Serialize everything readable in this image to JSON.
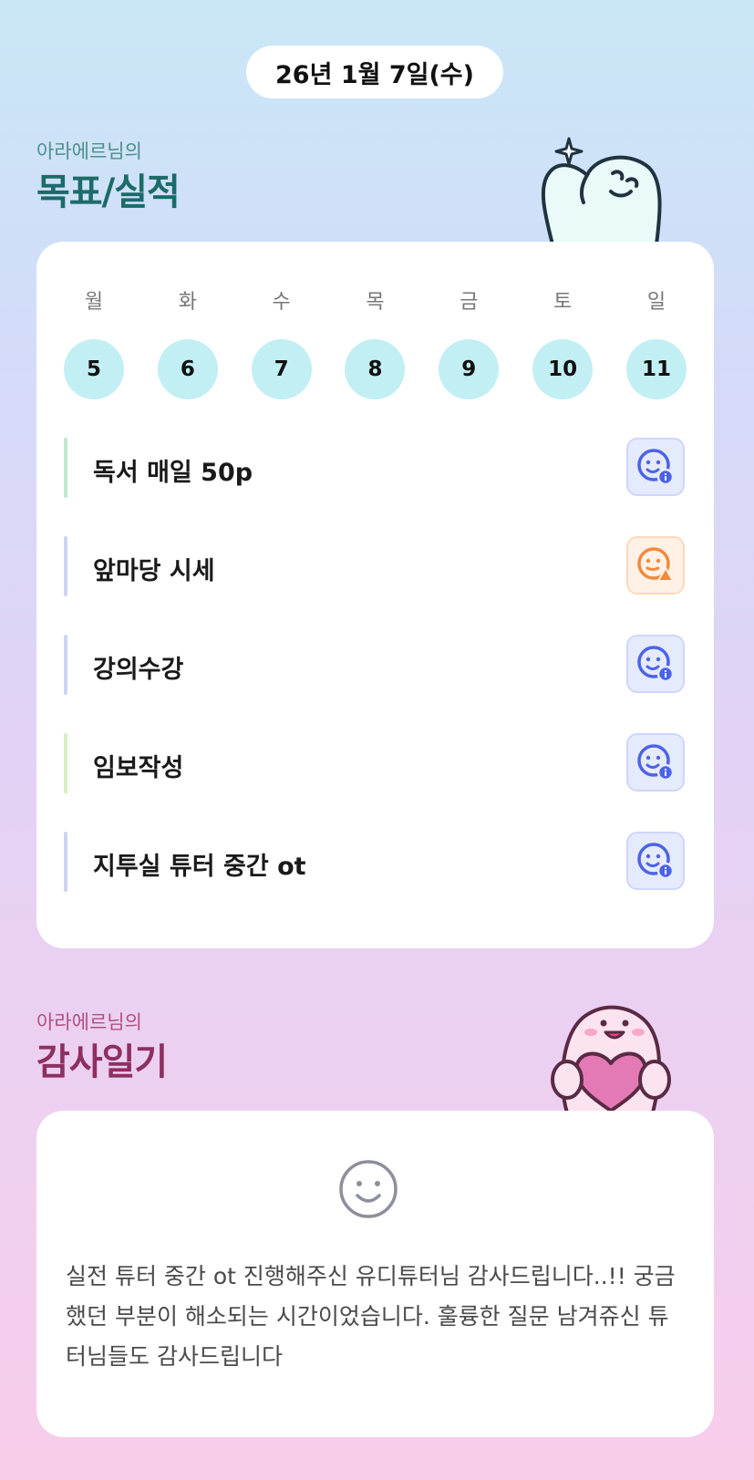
{
  "header": {
    "date": "26년 1월 7일(수)"
  },
  "goals_section": {
    "subtitle": "아라에르님의",
    "title": "목표/실적",
    "week": {
      "days": [
        "월",
        "화",
        "수",
        "목",
        "금",
        "토",
        "일"
      ],
      "dates": [
        "5",
        "6",
        "7",
        "8",
        "9",
        "10",
        "11"
      ]
    },
    "items": [
      {
        "label": "독서 매일 50p",
        "accent": "#bfe9cf",
        "status": "good",
        "status_icon": "smiley-info-icon"
      },
      {
        "label": "앞마당 시세",
        "accent": "#cdd3f1",
        "status": "warn",
        "status_icon": "smiley-warning-icon"
      },
      {
        "label": "강의수강",
        "accent": "#cdd3f1",
        "status": "good",
        "status_icon": "smiley-info-icon"
      },
      {
        "label": "임보작성",
        "accent": "#d7efbf",
        "status": "good",
        "status_icon": "smiley-info-icon"
      },
      {
        "label": "지투실 튜터 중간 ot",
        "accent": "#cdd3f1",
        "status": "good",
        "status_icon": "smiley-info-icon"
      }
    ]
  },
  "thanks_section": {
    "subtitle": "아라에르님의",
    "title": "감사일기",
    "icon": "smiley-face-icon",
    "text": "실전 튜터 중간 ot 진행해주신 유디튜터님 감사드립니다..!! 궁금했던 부분이 해소되는 시간이었습니다. 훌륭한 질문 남겨쥬신 튜터님들도 감사드립니다"
  },
  "colors": {
    "goal_title": "#1b6b68",
    "thanks_title": "#8d2f60",
    "date_circle": "#c2eff4",
    "status_good": "#4b63e6",
    "status_warn": "#f08a3c"
  }
}
